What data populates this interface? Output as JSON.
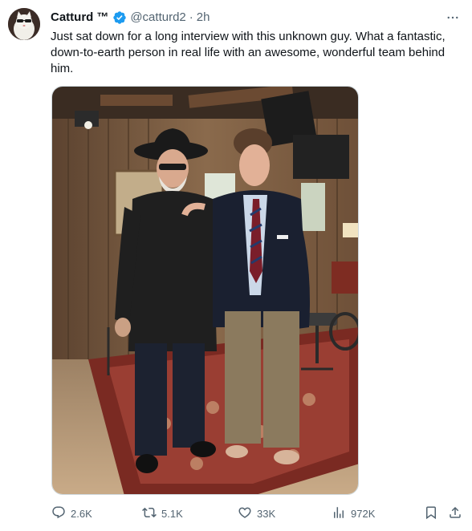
{
  "author": {
    "display_name": "Catturd",
    "trademark": "™",
    "handle": "@catturd2",
    "separator": "·",
    "time": "2h"
  },
  "tweet": {
    "text": "Just sat down for a long interview with this unknown guy. What a fantastic, down-to-earth person in real life with an awesome, wonderful team behind him."
  },
  "actions": {
    "reply_count": "2.6K",
    "retweet_count": "5.1K",
    "like_count": "33K",
    "view_count": "972K"
  },
  "colors": {
    "verified_blue": "#1d9bf0",
    "secondary_text": "#536471"
  },
  "icons": {
    "verified": "verified-badge-icon",
    "more": "more-icon",
    "reply": "reply-icon",
    "retweet": "retweet-icon",
    "like": "like-icon",
    "views": "views-icon",
    "bookmark": "bookmark-icon",
    "share": "share-icon"
  }
}
